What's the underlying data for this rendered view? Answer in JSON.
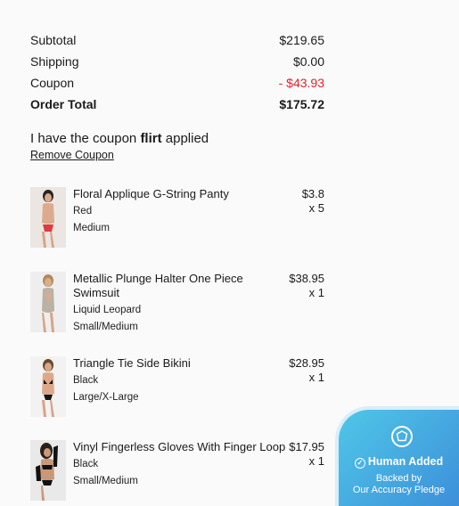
{
  "summary": {
    "subtotal_label": "Subtotal",
    "subtotal_value": "$219.65",
    "shipping_label": "Shipping",
    "shipping_value": "$0.00",
    "coupon_label": "Coupon",
    "coupon_value": "- $43.93",
    "total_label": "Order Total",
    "total_value": "$175.72",
    "discount_color": "#e0242a"
  },
  "coupon": {
    "prefix": "I have the coupon ",
    "code": "flirt",
    "suffix": " applied",
    "remove_label": "Remove Coupon"
  },
  "items": [
    {
      "name": "Floral Applique G-String Panty",
      "color": "Red",
      "size": "Medium",
      "price": "$3.8",
      "qty": "x 5"
    },
    {
      "name": "Metallic Plunge Halter One Piece Swimsuit",
      "color": "Liquid Leopard",
      "size": "Small/Medium",
      "price": "$38.95",
      "qty": "x 1"
    },
    {
      "name": "Triangle Tie Side Bikini",
      "color": "Black",
      "size": "Large/X-Large",
      "price": "$28.95",
      "qty": "x 1"
    },
    {
      "name": "Vinyl Fingerless Gloves With Finger Loop",
      "color": "Black",
      "size": "Small/Medium",
      "price": "$17.95",
      "qty": "x 1"
    }
  ],
  "badge": {
    "title": "Human Added",
    "line1": "Backed by",
    "line2": "Our Accuracy Pledge",
    "icon": "shield-icon"
  }
}
